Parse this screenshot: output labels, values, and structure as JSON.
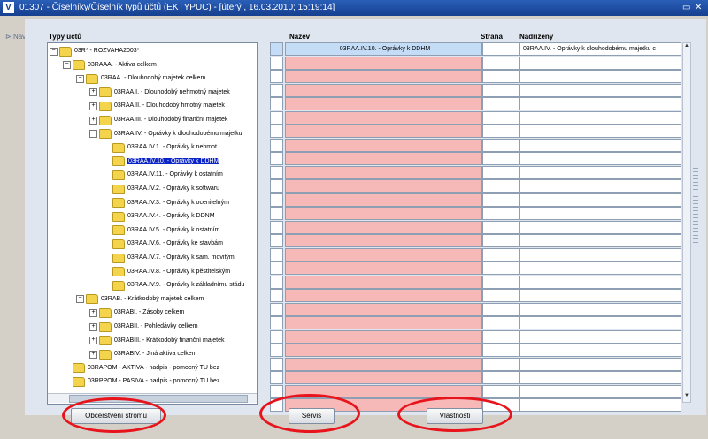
{
  "window": {
    "title": "01307 - Číselníky/Číselník typů účtů (EKTYPUC) - [úterý , 16.03.2010; 15:19:14]",
    "logo": "V",
    "controls": [
      "▭",
      "✕"
    ]
  },
  "nav": {
    "label": "Nav"
  },
  "tree": {
    "header": "Typy účtů",
    "nodes": [
      {
        "label": "03R* - ROZVAHA2003*",
        "toggle": "−",
        "level": 1
      },
      {
        "label": "03RAAA. - Aktiva celkem",
        "toggle": "−",
        "level": 2
      },
      {
        "label": "03RAA. - Dlouhodobý majetek celkem",
        "toggle": "−",
        "level": 3
      },
      {
        "label": "03RAA.I. - Dlouhodobý nehmotný majetek",
        "toggle": "+",
        "level": 4
      },
      {
        "label": "03RAA.II. - Dlouhodobý hmotný majetek",
        "toggle": "+",
        "level": 4
      },
      {
        "label": "03RAA.III. - Dlouhodobý finanční majetek",
        "toggle": "+",
        "level": 4
      },
      {
        "label": "03RAA.IV. - Oprávky k dlouhodobému majetku",
        "toggle": "−",
        "level": 4
      },
      {
        "label": "03RAA.IV.1. - Oprávky k nehmot.",
        "toggle": "",
        "level": 5
      },
      {
        "label": "03RAA.IV.10. - Oprávky k DDHM",
        "toggle": "",
        "level": 5,
        "selected": true
      },
      {
        "label": "03RAA.IV.11. - Oprávky k ostatním",
        "toggle": "",
        "level": 5
      },
      {
        "label": "03RAA.IV.2. - Oprávky k softwaru",
        "toggle": "",
        "level": 5
      },
      {
        "label": "03RAA.IV.3. - Oprávky k ocenitelným",
        "toggle": "",
        "level": 5
      },
      {
        "label": "03RAA.IV.4. - Oprávky k DDNM",
        "toggle": "",
        "level": 5
      },
      {
        "label": "03RAA.IV.5. - Oprávky k ostatním",
        "toggle": "",
        "level": 5
      },
      {
        "label": "03RAA.IV.6. - Oprávky ke stavbám",
        "toggle": "",
        "level": 5
      },
      {
        "label": "03RAA.IV.7. - Oprávky k sam. movitým",
        "toggle": "",
        "level": 5
      },
      {
        "label": "03RAA.IV.8. - Oprávky k pěstitelským",
        "toggle": "",
        "level": 5
      },
      {
        "label": "03RAA.IV.9. - Oprávky k základnímu stádu",
        "toggle": "",
        "level": 5
      },
      {
        "label": "03RAB. - Krátkodobý majetek celkem",
        "toggle": "−",
        "level": 3
      },
      {
        "label": "03RABI. - Zásoby celkem",
        "toggle": "+",
        "level": 4
      },
      {
        "label": "03RABII. - Pohledávky celkem",
        "toggle": "+",
        "level": 4
      },
      {
        "label": "03RABIII. - Krátkodobý finanční majetek",
        "toggle": "+",
        "level": 4
      },
      {
        "label": "03RABIV. - Jiná aktiva celkem",
        "toggle": "+",
        "level": 4
      },
      {
        "label": "03RAPOM - AKTIVA - nadpis - pomocný TU bez",
        "toggle": "",
        "level": 2
      },
      {
        "label": "03RPPOM - PASIVA - nadpis - pomocný TU bez",
        "toggle": "",
        "level": 2
      }
    ]
  },
  "grid": {
    "columns": {
      "nazev": "Název",
      "strana": "Strana",
      "nadrizeny": "Nadřízený"
    },
    "rows": [
      {
        "nazev": "03RAA.IV.10. - Oprávky k DDHM",
        "strana": "",
        "nadrizeny": "03RAA.IV. - Oprávky k dlouhodobému majetku c",
        "active": true
      }
    ],
    "empty_row_count": 26
  },
  "buttons": {
    "refresh": "Občerstvení stromu",
    "servis": "Servis",
    "vlastnosti": "Vlastnosti"
  },
  "colors": {
    "annotation_ring": "#e8141c",
    "nazev_cell": "#f7b8b8",
    "tree_selection": "#0a24c8",
    "titlebar": "#1d4ea3"
  }
}
